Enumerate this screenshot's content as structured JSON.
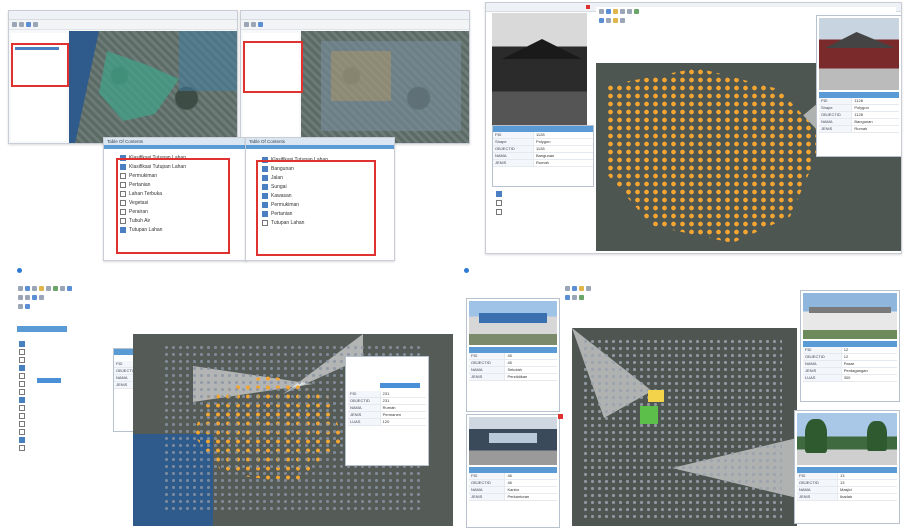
{
  "panel_a": {
    "left_window_title": "",
    "right_window_title": "",
    "toc_left_title": "Table Of Contents",
    "toc_right_title": "Table Of Contents",
    "toc_left_items": [
      "Klasifikasi Tutupan Lahan",
      "Klasifikasi Tutupan Lahan",
      "Permukiman",
      "Pertanian",
      "Lahan Terbuka",
      "Vegetasi",
      "Perairan",
      "Tubuh Air",
      "Tutupan Lahan"
    ],
    "toc_right_items": [
      "Klasifikasi Tutupan Lahan",
      "Bangunan",
      "Jalan",
      "Sungai",
      "Kawasan",
      "Permukiman",
      "Pertanian",
      "Tutupan Lahan"
    ]
  },
  "panel_b": {
    "window_title": "",
    "attr_title": "",
    "popup_title": "",
    "attr_rows": [
      {
        "k": "FID",
        "v": "1128"
      },
      {
        "k": "Shape",
        "v": "Polygon"
      },
      {
        "k": "OBJECTID",
        "v": "1128"
      },
      {
        "k": "NAMA",
        "v": "Bangunan"
      },
      {
        "k": "JENIS",
        "v": "Rumah"
      }
    ],
    "popup_rows": [
      {
        "k": "FID",
        "v": "1128"
      },
      {
        "k": "Shape",
        "v": "Polygon"
      },
      {
        "k": "OBJECTID",
        "v": "1128"
      },
      {
        "k": "NAMA",
        "v": "Bangunan"
      },
      {
        "k": "JENIS",
        "v": "Rumah"
      }
    ]
  },
  "panel_c": {
    "toc_rows": [
      "",
      "",
      "",
      "",
      "",
      "",
      "",
      "",
      "",
      "",
      "",
      "",
      "",
      ""
    ],
    "attr_rows": [
      {
        "k": "FID",
        "v": "231"
      },
      {
        "k": "OBJECTID",
        "v": "231"
      },
      {
        "k": "NAMA",
        "v": "Rumah"
      },
      {
        "k": "JENIS",
        "v": "Permanen"
      }
    ],
    "popup_rows": [
      {
        "k": "FID",
        "v": "231"
      },
      {
        "k": "OBJECTID",
        "v": "231"
      },
      {
        "k": "NAMA",
        "v": "Rumah"
      },
      {
        "k": "JENIS",
        "v": "Permanen"
      },
      {
        "k": "LUAS",
        "v": "120"
      }
    ]
  },
  "panel_d": {
    "top_left_rows": [
      {
        "k": "FID",
        "v": "45"
      },
      {
        "k": "OBJECTID",
        "v": "45"
      },
      {
        "k": "NAMA",
        "v": "Sekolah"
      },
      {
        "k": "JENIS",
        "v": "Pendidikan"
      }
    ],
    "bottom_left_rows": [
      {
        "k": "FID",
        "v": "46"
      },
      {
        "k": "OBJECTID",
        "v": "46"
      },
      {
        "k": "NAMA",
        "v": "Kantor"
      },
      {
        "k": "JENIS",
        "v": "Perkantoran"
      }
    ],
    "top_right_rows": [
      {
        "k": "FID",
        "v": "12"
      },
      {
        "k": "OBJECTID",
        "v": "12"
      },
      {
        "k": "NAMA",
        "v": "Pasar"
      },
      {
        "k": "JENIS",
        "v": "Perdagangan"
      },
      {
        "k": "LUAS",
        "v": "300"
      }
    ],
    "bottom_right_rows": [
      {
        "k": "FID",
        "v": "13"
      },
      {
        "k": "OBJECTID",
        "v": "13"
      },
      {
        "k": "NAMA",
        "v": "Masjid"
      },
      {
        "k": "JENIS",
        "v": "Ibadah"
      }
    ]
  },
  "colors": {
    "highlight_box": "#e03131",
    "building_fill": "#f2a531",
    "selected_building": "#5cbf4a",
    "header_blue": "#5b9bd5"
  }
}
